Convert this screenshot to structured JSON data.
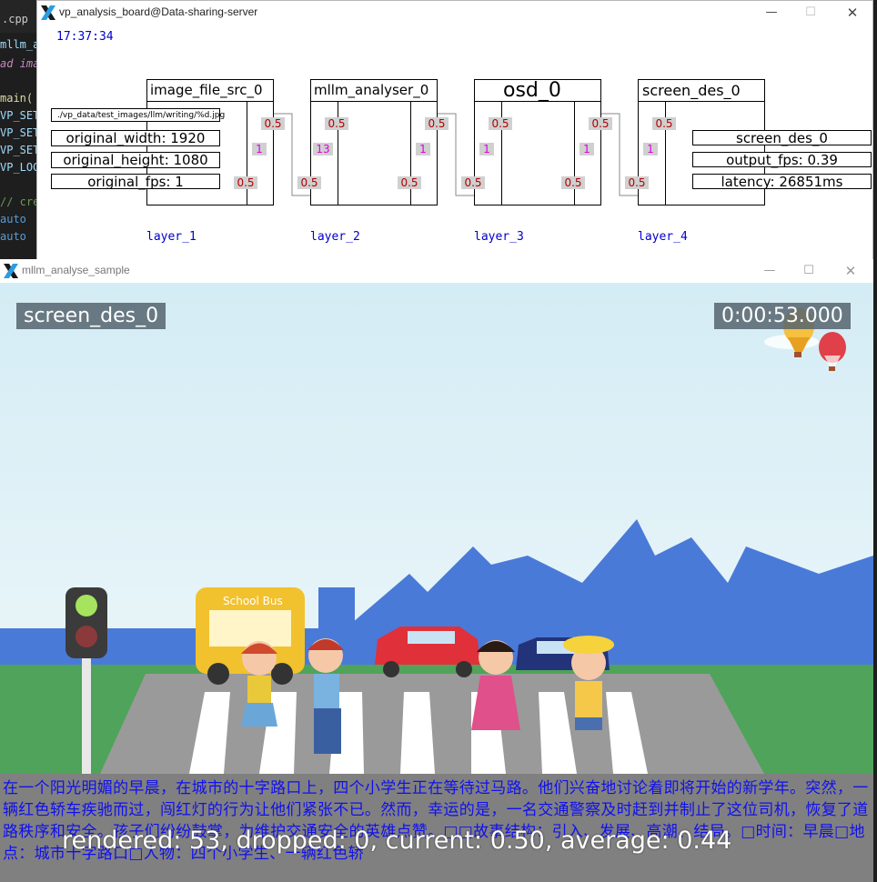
{
  "editor": {
    "tab_label": ".cpp",
    "lines": [
      "mllm_a",
      "ad ima",
      "",
      "main(",
      "VP_SET",
      "VP_SET",
      "VP_SET",
      "VP_LOG",
      "",
      "// cre",
      "auto",
      "auto"
    ]
  },
  "board_window": {
    "title": "vp_analysis_board@Data-sharing-server",
    "clock": "17:37:34",
    "controls": {
      "minimize": "—",
      "maximize": "☐",
      "close": "✕"
    },
    "nodes": [
      {
        "name": "image_file_src_0",
        "layer": "layer_1",
        "out_q": "0.5",
        "mid_q": "1",
        "in_q": "0.5"
      },
      {
        "name": "mllm_analyser_0",
        "layer": "layer_2",
        "left_q": "0.5",
        "out_q": "0.5",
        "mid_left": "13",
        "mid_right": "1",
        "in_left": "0.5",
        "in_right": "0.5",
        "top_left": "0.5"
      },
      {
        "name": "osd_0",
        "layer": "layer_3",
        "top_left": "0.5",
        "out_q": "0.5",
        "mid_left": "1",
        "mid_right": "1",
        "in_left": "0.5",
        "in_right": "0.5"
      },
      {
        "name": "screen_des_0",
        "layer": "layer_4",
        "top_left": "0.5",
        "mid_left": "1",
        "in_left": "0.5"
      }
    ],
    "src_attrs": {
      "path": "./vp_data/test_images/llm/writing/%d.jpg",
      "width": "original_width: 1920",
      "height": "original_height: 1080",
      "fps": "original_fps: 1"
    },
    "des_attrs": {
      "name": "screen_des_0",
      "fps": "output_fps: 0.39",
      "latency": "latency: 26851ms"
    }
  },
  "sample_window": {
    "title": "mllm_analyse_sample",
    "controls": {
      "minimize": "—",
      "maximize": "☐",
      "close": "✕"
    },
    "osd_name": "screen_des_0",
    "timestamp": "0:00:53.000",
    "bus_sign": "School Bus",
    "caption": "在一个阳光明媚的早晨，在城市的十字路口上，四个小学生正在等待过马路。他们兴奋地讨论着即将开始的新学年。突然，一辆红色轿车疾驰而过，闯红灯的行为让他们紧张不已。然而，幸运的是，一名交通警察及时赶到并制止了这位司机，恢复了道路秩序和安全。孩子们纷纷鼓掌，为维护交通安全的英雄点赞。□□故事结构：引入、发展、高潮、结局。□时间：早晨□地点：城市十字路口□人物：四个小学生、一辆红色轿",
    "stats": "rendered: 53, dropped: 0, current: 0.50, average: 0.44"
  },
  "colors": {
    "clock": "#0000cc",
    "queue_red": "#b00000",
    "queue_magenta": "#e000e0",
    "caption_blue": "#1010ee",
    "caption_band": "#808080"
  }
}
